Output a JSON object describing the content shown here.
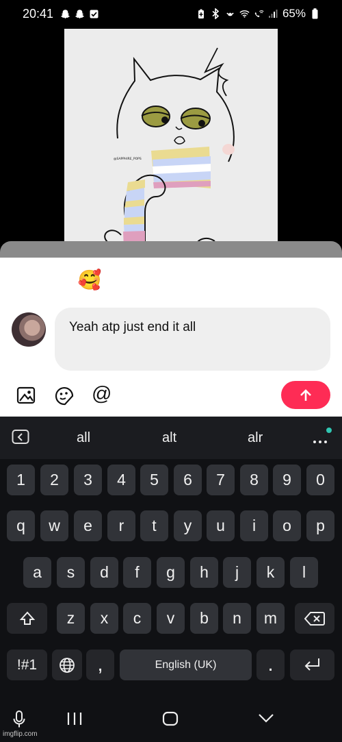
{
  "status_bar": {
    "time": "20:41",
    "battery": "65%"
  },
  "image_preview": {
    "watermark_text": "@SAPPHIRE_POPS"
  },
  "quick_emojis": [
    "😁",
    "🥰",
    "😂",
    "😳",
    "😏",
    "😅"
  ],
  "comment": {
    "value": "Yeah atp just end it all"
  },
  "composer": {
    "mention_symbol": "@"
  },
  "keyboard": {
    "suggestions": [
      "all",
      "alt",
      "alr"
    ],
    "row_numbers": [
      "1",
      "2",
      "3",
      "4",
      "5",
      "6",
      "7",
      "8",
      "9",
      "0"
    ],
    "row_1": [
      "q",
      "w",
      "e",
      "r",
      "t",
      "y",
      "u",
      "i",
      "o",
      "p"
    ],
    "row_2": [
      "a",
      "s",
      "d",
      "f",
      "g",
      "h",
      "j",
      "k",
      "l"
    ],
    "row_3": [
      "z",
      "x",
      "c",
      "v",
      "b",
      "n",
      "m"
    ],
    "symbols_label": "!#1",
    "comma": ",",
    "space_label": "English (UK)",
    "period": "."
  },
  "watermark": "imgflip.com",
  "colors": {
    "send_button": "#fe2c55",
    "keyboard_bg": "#101114",
    "key_bg": "#313338",
    "online_dot": "#30c6b2"
  }
}
